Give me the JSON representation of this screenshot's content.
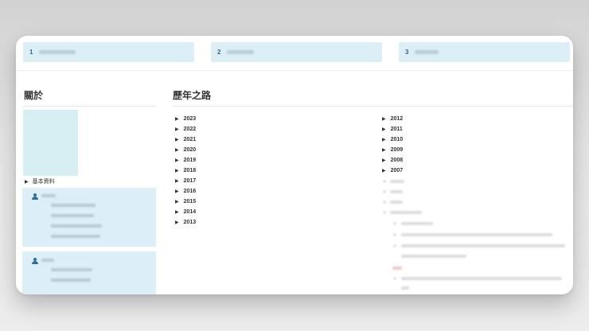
{
  "steps": [
    {
      "num": "1"
    },
    {
      "num": "2"
    },
    {
      "num": "3"
    }
  ],
  "about": {
    "title": "關於",
    "basic_info_label": "基本資料"
  },
  "history": {
    "title": "歷年之路",
    "years_left": [
      "2023",
      "2022",
      "2021",
      "2020",
      "2019",
      "2018",
      "2017",
      "2016",
      "2015",
      "2014",
      "2013"
    ],
    "years_right": [
      "2012",
      "2011",
      "2010",
      "2009",
      "2008",
      "2007"
    ]
  },
  "colors": {
    "step_bg": "#dceef6",
    "accent": "#2b6f9b",
    "photo_placeholder": "#d5eef2",
    "card_bg": "#ffffff"
  },
  "icons": {
    "expand": "triangle-right-icon",
    "person": "person-icon"
  }
}
